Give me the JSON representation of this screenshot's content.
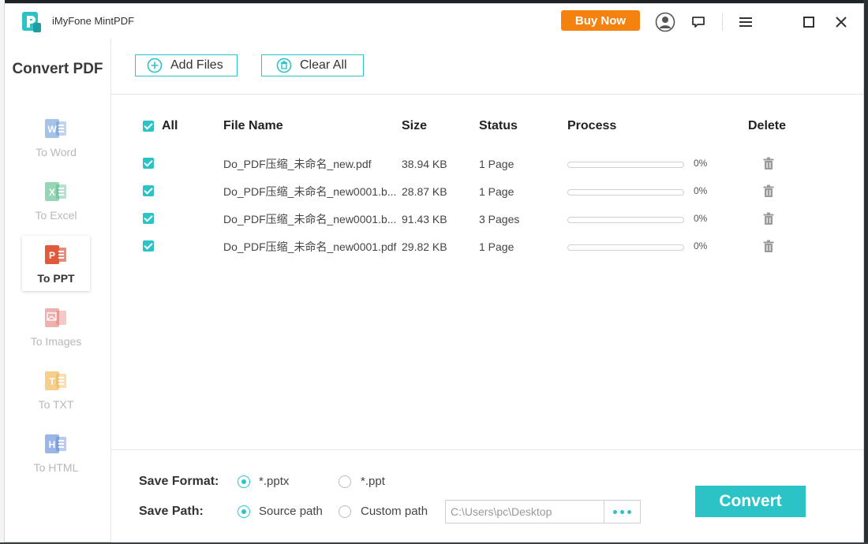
{
  "app": {
    "title": "iMyFone MintPDF",
    "accent": "#2bc3c6",
    "buy_color": "#f5820e"
  },
  "titlebar": {
    "buy_label": "Buy Now",
    "icons": [
      "account-icon",
      "feedback-icon",
      "menu-icon",
      "maximize-icon",
      "close-icon"
    ]
  },
  "sidebar": {
    "title": "Convert PDF",
    "items": [
      {
        "label": "To Word",
        "letter": "W",
        "color": "#5b8fd6",
        "active": false
      },
      {
        "label": "To Excel",
        "letter": "X",
        "color": "#3fb37a",
        "active": false
      },
      {
        "label": "To PPT",
        "letter": "P",
        "color": "#e05a3c",
        "active": true
      },
      {
        "label": "To Images",
        "letter": "",
        "color": "#e46f6f",
        "active": false
      },
      {
        "label": "To TXT",
        "letter": "T",
        "color": "#f0a830",
        "active": false
      },
      {
        "label": "To HTML",
        "letter": "H",
        "color": "#4a78d4",
        "active": false
      }
    ]
  },
  "toolbar": {
    "add_label": "Add Files",
    "clear_label": "Clear All"
  },
  "table": {
    "headers": {
      "all": "All",
      "file_name": "File Name",
      "size": "Size",
      "status": "Status",
      "process": "Process",
      "delete": "Delete"
    },
    "rows": [
      {
        "name": "Do_PDF压缩_未命名_new.pdf",
        "size": "38.94 KB",
        "status": "1 Page",
        "progress": 0,
        "pct": "0%"
      },
      {
        "name": "Do_PDF压缩_未命名_new0001.b...",
        "size": "28.87 KB",
        "status": "1 Page",
        "progress": 0,
        "pct": "0%"
      },
      {
        "name": "Do_PDF压缩_未命名_new0001.b...",
        "size": "91.43 KB",
        "status": "3 Pages",
        "progress": 0,
        "pct": "0%"
      },
      {
        "name": "Do_PDF压缩_未命名_new0001.pdf",
        "size": "29.82 KB",
        "status": "1 Page",
        "progress": 0,
        "pct": "0%"
      }
    ]
  },
  "bottom": {
    "save_format_label": "Save Format:",
    "format_options": [
      "*.pptx",
      "*.ppt"
    ],
    "format_selected": "*.pptx",
    "save_path_label": "Save Path:",
    "path_options": [
      "Source path",
      "Custom path"
    ],
    "path_selected": "Source path",
    "path_value": "C:\\Users\\pc\\Desktop",
    "convert_label": "Convert"
  }
}
